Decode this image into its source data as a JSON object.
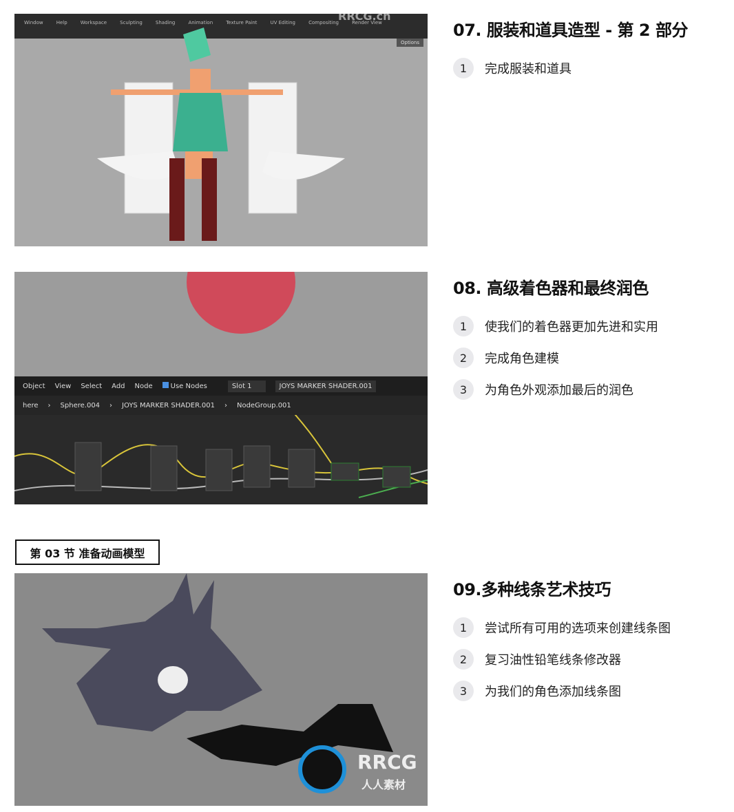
{
  "lessons": [
    {
      "title": "07. 服装和道具造型 - 第 2 部分",
      "items": [
        {
          "n": "1",
          "text": "完成服装和道具"
        }
      ]
    },
    {
      "title": "08. 高级着色器和最终润色",
      "items": [
        {
          "n": "1",
          "text": "使我们的着色器更加先进和实用"
        },
        {
          "n": "2",
          "text": "完成角色建模"
        },
        {
          "n": "3",
          "text": "为角色外观添加最后的润色"
        }
      ]
    },
    {
      "title": "09.多种线条艺术技巧",
      "items": [
        {
          "n": "1",
          "text": "尝试所有可用的选项来创建线条图"
        },
        {
          "n": "2",
          "text": "复习油性铅笔线条修改器"
        },
        {
          "n": "3",
          "text": "为我们的角色添加线条图"
        }
      ]
    }
  ],
  "section_label": "第 03 节 准备动画模型",
  "shot1": {
    "menu": [
      "Window",
      "Help",
      "Workspace",
      "Sculpting",
      "Shading",
      "Animation",
      "Texture Paint",
      "UV Editing",
      "Compositing",
      "Render View"
    ],
    "options": "Options"
  },
  "shot2": {
    "toolbar": [
      "Object",
      "View",
      "Select",
      "Add",
      "Node",
      "Use Nodes",
      "Slot 1",
      "JOYS MARKER SHADER.001"
    ],
    "breadcrumb": [
      "here",
      "Sphere.004",
      "JOYS MARKER SHADER.001",
      "NodeGroup.001"
    ]
  },
  "watermark": {
    "top": "RRCG.cn",
    "logo": "RRCG",
    "logo_sub": "人人素材"
  },
  "colors": {
    "accent_red": "#d04a5a",
    "node_wire": "#d9c53a",
    "logo_blue": "#1e90d8"
  }
}
